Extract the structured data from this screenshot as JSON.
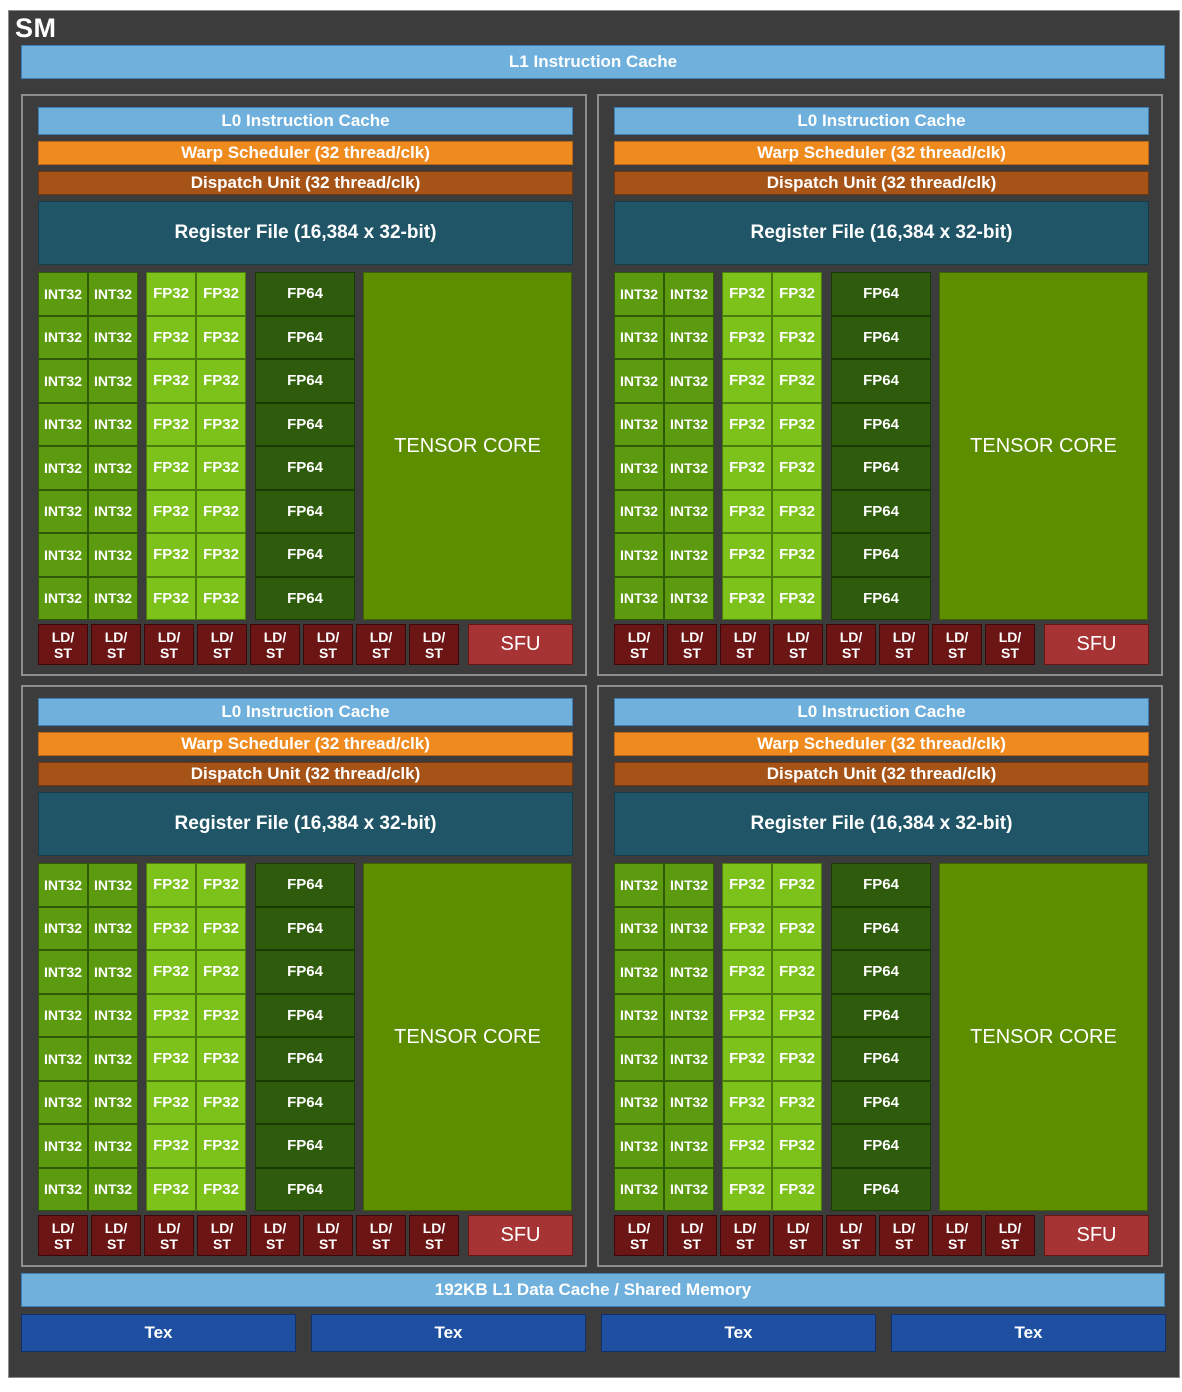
{
  "sm_label": "SM",
  "l1_instruction_cache": "L1 Instruction Cache",
  "partition": {
    "l0_cache": "L0 Instruction Cache",
    "warp_scheduler": "Warp Scheduler (32 thread/clk)",
    "dispatch_unit": "Dispatch Unit (32 thread/clk)",
    "register_file": "Register File (16,384 x 32-bit)",
    "int32": "INT32",
    "fp32": "FP32",
    "fp64": "FP64",
    "tensor_core": "TENSOR CORE",
    "ld": "LD/",
    "st": "ST",
    "sfu": "SFU",
    "rows": 8,
    "ldst_units": 8
  },
  "partitions_count": 4,
  "l1_data_cache": "192KB L1 Data Cache / Shared Memory",
  "tex_units": [
    "Tex",
    "Tex",
    "Tex",
    "Tex"
  ],
  "colors": {
    "background": "#3c3c3c",
    "cache": "#6fb0dc",
    "warp_scheduler": "#ef8a1e",
    "dispatch_unit": "#a55316",
    "register_file": "#1f5566",
    "int32": "#5c9a10",
    "fp32": "#7dc21a",
    "fp64": "#2f5c0c",
    "tensor_core": "#5c8e00",
    "ldst": "#6b1515",
    "sfu": "#a63434",
    "tex": "#1f4fa0"
  }
}
